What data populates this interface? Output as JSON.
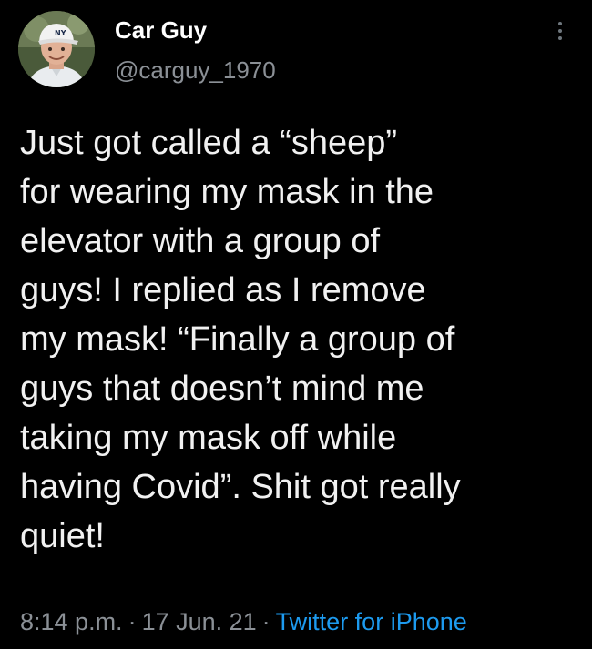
{
  "user": {
    "display_name": "Car Guy",
    "handle": "@carguy_1970",
    "avatar_icon": "profile-photo"
  },
  "tweet": {
    "text": "Just got called a “sheep”\nfor wearing my mask in the\nelevator with a group of\nguys! I replied as I remove\nmy mask! “Finally a group of\nguys that doesn’t mind me\ntaking my mask off while\nhaving Covid”.  Shit got really\nquiet!",
    "time": "8:14 p.m.",
    "date": "17 Jun. 21",
    "separator": "·",
    "source": "Twitter for iPhone"
  },
  "colors": {
    "background": "#000000",
    "name": "#ffffff",
    "secondary": "#8b9096",
    "link": "#1d9bf0"
  },
  "icons": {
    "more": "more-vertical-icon"
  }
}
